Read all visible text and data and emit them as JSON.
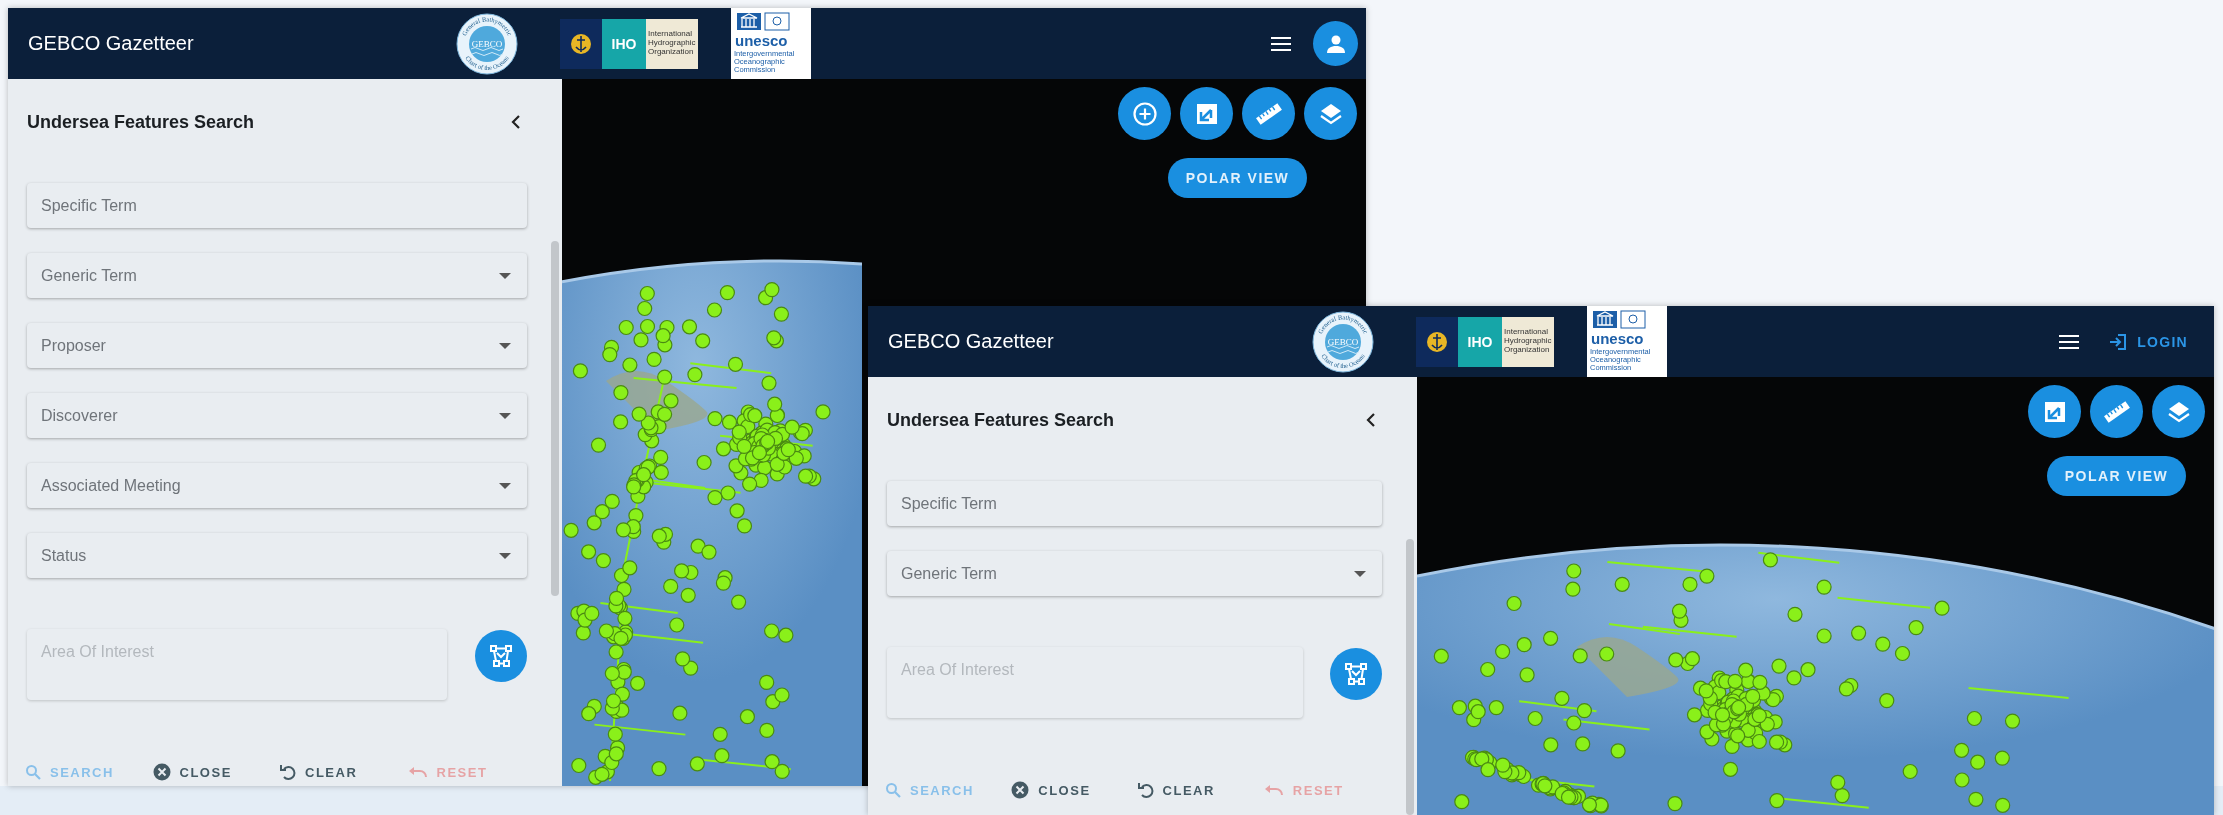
{
  "windows": [
    {
      "header": {
        "title": "GEBCO Gazetteer",
        "logos": [
          {
            "kind": "gebco",
            "text": "GEBCO",
            "ring_top": "General Bathymetric",
            "ring_bottom": "Chart of the Oceans"
          },
          {
            "kind": "iho",
            "text": "IHO",
            "caption": [
              "International",
              "Hydrographic",
              "Organization"
            ]
          },
          {
            "kind": "unesco",
            "text": "unesco",
            "caption": [
              "Intergovernmental",
              "Oceanographic",
              "Commission"
            ]
          }
        ],
        "actions": [
          {
            "kind": "menu"
          },
          {
            "kind": "avatar"
          }
        ]
      },
      "sidebar": {
        "title": "Undersea Features Search",
        "fields": [
          {
            "kind": "text",
            "placeholder": "Specific Term"
          },
          {
            "kind": "select",
            "placeholder": "Generic Term"
          },
          {
            "kind": "select",
            "placeholder": "Proposer"
          },
          {
            "kind": "select",
            "placeholder": "Discoverer"
          },
          {
            "kind": "select",
            "placeholder": "Associated Meeting"
          },
          {
            "kind": "select",
            "placeholder": "Status"
          }
        ],
        "area": {
          "placeholder": "Area Of Interest"
        },
        "actions": [
          {
            "kind": "search",
            "label": "SEARCH",
            "disabled": true
          },
          {
            "kind": "close",
            "label": "CLOSE",
            "disabled": false
          },
          {
            "kind": "clear",
            "label": "CLEAR",
            "disabled": false
          },
          {
            "kind": "reset",
            "label": "RESET",
            "disabled": true
          }
        ]
      },
      "map": {
        "tools": [
          {
            "kind": "zoom-in"
          },
          {
            "kind": "extent"
          },
          {
            "kind": "measure"
          },
          {
            "kind": "layers"
          }
        ],
        "polar_button": "POLAR VIEW"
      }
    },
    {
      "header": {
        "title": "GEBCO Gazetteer",
        "logos": [
          {
            "kind": "gebco",
            "text": "GEBCO",
            "ring_top": "General Bathymetric",
            "ring_bottom": "Chart of the Oceans"
          },
          {
            "kind": "iho",
            "text": "IHO",
            "caption": [
              "International",
              "Hydrographic",
              "Organization"
            ]
          },
          {
            "kind": "unesco",
            "text": "unesco",
            "caption": [
              "Intergovernmental",
              "Oceanographic",
              "Commission"
            ]
          }
        ],
        "actions": [
          {
            "kind": "menu"
          },
          {
            "kind": "login",
            "label": "LOGIN"
          }
        ]
      },
      "sidebar": {
        "title": "Undersea Features Search",
        "fields": [
          {
            "kind": "text",
            "placeholder": "Specific Term"
          },
          {
            "kind": "select",
            "placeholder": "Generic Term"
          }
        ],
        "area": {
          "placeholder": "Area Of Interest"
        },
        "actions": [
          {
            "kind": "search",
            "label": "SEARCH",
            "disabled": true
          },
          {
            "kind": "close",
            "label": "CLOSE",
            "disabled": false
          },
          {
            "kind": "clear",
            "label": "CLEAR",
            "disabled": false
          },
          {
            "kind": "reset",
            "label": "RESET",
            "disabled": true
          }
        ]
      },
      "map": {
        "tools": [
          {
            "kind": "extent"
          },
          {
            "kind": "measure"
          },
          {
            "kind": "layers"
          }
        ],
        "polar_button": "POLAR VIEW"
      }
    }
  ]
}
